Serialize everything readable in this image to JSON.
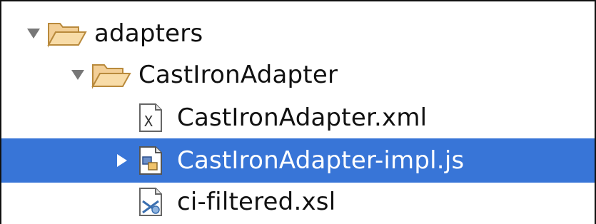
{
  "tree": {
    "items": [
      {
        "label": "adapters",
        "type": "folder",
        "expanded": true,
        "selected": false,
        "icon": "folder-open-icon"
      },
      {
        "label": "CastIronAdapter",
        "type": "folder",
        "expanded": true,
        "selected": false,
        "icon": "folder-open-icon"
      },
      {
        "label": "CastIronAdapter.xml",
        "type": "file",
        "selected": false,
        "icon": "xml-file-icon",
        "icon_letter": "X"
      },
      {
        "label": "CastIronAdapter-impl.js",
        "type": "file",
        "expandable": true,
        "expanded": false,
        "selected": true,
        "icon": "js-file-icon"
      },
      {
        "label": "ci-filtered.xsl",
        "type": "file",
        "selected": false,
        "icon": "xsl-file-icon"
      }
    ]
  },
  "colors": {
    "selection": "#3875d7",
    "folder_fill": "#f8d7a0",
    "folder_stroke": "#b98a3c",
    "triangle": "#777777"
  }
}
